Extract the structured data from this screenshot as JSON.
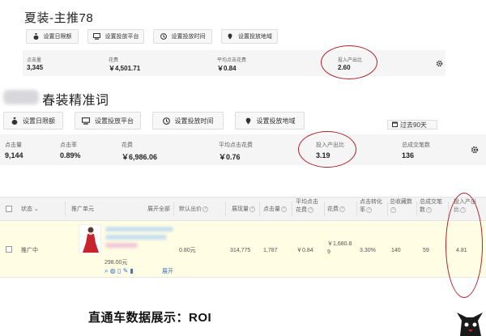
{
  "section1": {
    "title": "夏装-主推78",
    "buttons": [
      "设置日限额",
      "设置投放平台",
      "设置投放时间",
      "设置投放地域"
    ],
    "stats": [
      {
        "label": "点击量",
        "value": "3,345"
      },
      {
        "label": "花费",
        "value": "￥4,501.71"
      },
      {
        "label": "平均点击花费",
        "value": "￥0.84"
      },
      {
        "label": "投入产出比",
        "value": "2.60"
      }
    ]
  },
  "section2": {
    "title": "春装精准词",
    "buttons": [
      "设置日限额",
      "设置投放平台",
      "设置投放时间",
      "设置投放地域"
    ],
    "range": "过去90天",
    "stats": [
      {
        "label": "点击量",
        "value": "9,144"
      },
      {
        "label": "点击率",
        "value": "0.89%"
      },
      {
        "label": "花费",
        "value": "￥6,986.06"
      },
      {
        "label": "平均点击花费",
        "value": "￥0.76"
      },
      {
        "label": "投入产出比",
        "value": "3.19"
      },
      {
        "label": "总成交笔数",
        "value": "136"
      }
    ]
  },
  "table": {
    "headers": {
      "status": "状态",
      "unit": "推广单元",
      "expand": "展开全部",
      "default_bid": "默认出价",
      "impressions": "展现量",
      "clicks": "点击量",
      "avg_cpc": "平均点击花费",
      "cost": "花费",
      "cvr": "点击转化率",
      "fav": "总收藏数",
      "orders": "总成交笔数",
      "roi": "投入产出比"
    },
    "row": {
      "status": "推广中",
      "price": "298.00元",
      "expand": "展开",
      "default_bid": "0.80元",
      "impressions": "314,775",
      "clicks": "1,787",
      "avg_cpc": "￥0.84",
      "cost": "￥1,680.89",
      "cvr": "3.30%",
      "fav": "140",
      "orders": "59",
      "roi": "4.81"
    }
  },
  "caption": "直通车数据展示：ROI",
  "colors": {
    "highlight": "#b0202a",
    "row_bg": "#fffde3",
    "stats_bg": "#f5f5f5"
  }
}
